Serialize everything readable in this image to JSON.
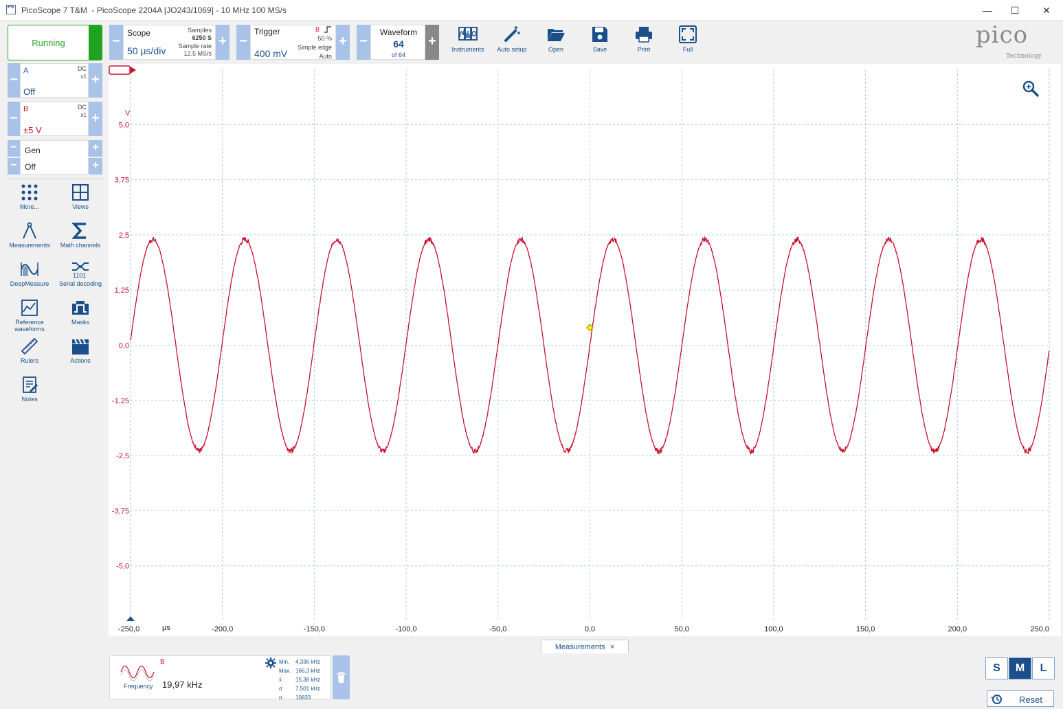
{
  "window": {
    "app_icon": "PS",
    "title": "PicoScope 7 T&M  - PicoScope 2204A [JO243/1069] - 10 MHz 100 MS/s",
    "minimize": "—",
    "maximize": "☐",
    "close": "✕"
  },
  "run": {
    "label": "Running",
    "color": "#2aa52a"
  },
  "scope": {
    "label": "Scope",
    "value": "50 µs/div",
    "samples_label": "Samples",
    "samples_value": "6250 S",
    "rate_label": "Sample rate",
    "rate_value": "12.5 MS/s"
  },
  "trigger": {
    "label": "Trigger",
    "value": "400 mV",
    "channel": "B",
    "percent": "50 %",
    "type": "Simple edge",
    "mode": "Auto"
  },
  "waveform": {
    "label": "Waveform",
    "value": "64",
    "of": "of 64"
  },
  "toolbar_buttons": [
    {
      "label": "Instruments",
      "icon": "instruments-icon"
    },
    {
      "label": "Auto setup",
      "icon": "wand-icon"
    },
    {
      "label": "Open",
      "icon": "folder-icon"
    },
    {
      "label": "Save",
      "icon": "save-icon"
    },
    {
      "label": "Print",
      "icon": "printer-icon"
    },
    {
      "label": "Full",
      "icon": "fullscreen-icon"
    }
  ],
  "logo": {
    "brand": "pico",
    "sub": "Technology"
  },
  "channels": {
    "a": {
      "name": "A",
      "coupling": "DC",
      "probe": "x1",
      "value": "Off",
      "color": "#1a4f8a"
    },
    "b": {
      "name": "B",
      "coupling": "DC",
      "probe": "x1",
      "value": "±5 V",
      "color": "#c8102e"
    },
    "gen": {
      "name": "Gen",
      "value": "Off"
    }
  },
  "side_tools": [
    {
      "label": "More...",
      "icon": "dots-grid-icon"
    },
    {
      "label": "Views",
      "icon": "views-grid-icon"
    },
    {
      "label": "Measurements",
      "icon": "compass-icon"
    },
    {
      "label": "Math channels",
      "icon": "sigma-icon"
    },
    {
      "label": "DeepMeasure",
      "icon": "deepmeasure-icon"
    },
    {
      "label": "Serial decoding",
      "icon": "serial-decoding-icon"
    },
    {
      "label": "Reference waveforms",
      "icon": "reference-waveform-icon"
    },
    {
      "label": "Masks",
      "icon": "mask-icon"
    },
    {
      "label": "Rulers",
      "icon": "ruler-icon"
    },
    {
      "label": "Actions",
      "icon": "clapper-icon"
    },
    {
      "label": "Notes",
      "icon": "notes-icon"
    }
  ],
  "chart_data": {
    "type": "line",
    "ylabel": "V",
    "xunit": "µs",
    "xlim": [
      -250,
      250
    ],
    "ylim": [
      -6.25,
      6.25
    ],
    "y_ticks": [
      "5,0",
      "3,75",
      "2,5",
      "1,25",
      "0,0",
      "-1,25",
      "-2,5",
      "-3,75",
      "-5,0"
    ],
    "y_tick_values": [
      5.0,
      3.75,
      2.5,
      1.25,
      0.0,
      -1.25,
      -2.5,
      -3.75,
      -5.0
    ],
    "x_ticks": [
      "-250,0",
      "-200,0",
      "-150,0",
      "-100,0",
      "-50,0",
      "0,0",
      "50,0",
      "100,0",
      "150,0",
      "200,0",
      "250,0"
    ],
    "x_tick_values": [
      -250,
      -200,
      -150,
      -100,
      -50,
      0,
      50,
      100,
      150,
      200,
      250
    ],
    "grid": true,
    "series": [
      {
        "channel": "B",
        "color": "#c8102e",
        "waveform": "sine",
        "amplitude_v": 2.4,
        "frequency_khz": 19.97,
        "phase_zero_crossing_us": 0
      }
    ],
    "trigger_marker": {
      "x": 0,
      "y": 0.4,
      "color": "#f2e600"
    }
  },
  "measurements_tab": {
    "label": "Measurements",
    "close": "×"
  },
  "measurement": {
    "channel": "B",
    "name": "Frequency",
    "value": "19,97 kHz",
    "stats": [
      {
        "k": "Min.",
        "v": "4,336 kHz"
      },
      {
        "k": "Max.",
        "v": "166,3 kHz"
      },
      {
        "k": "x̄",
        "v": "15,38 kHz"
      },
      {
        "k": "σ",
        "v": "7,501 kHz"
      },
      {
        "k": "n",
        "v": "10833"
      }
    ]
  },
  "size_buttons": [
    "S",
    "M",
    "L"
  ],
  "reset": {
    "label": "Reset"
  }
}
